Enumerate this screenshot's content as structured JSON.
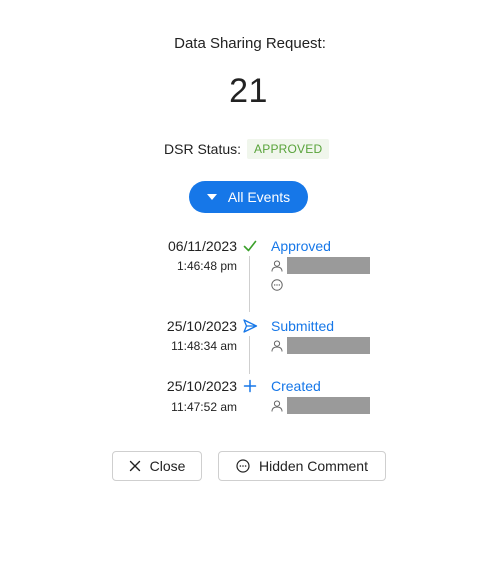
{
  "title": "Data Sharing Request:",
  "request_number": "21",
  "status": {
    "label": "DSR Status:",
    "value": "APPROVED",
    "color": "#58a33a"
  },
  "events_filter": {
    "label": "All Events",
    "icon": "caret-down-icon",
    "color": "#1677e8"
  },
  "events": [
    {
      "date": "06/11/2023",
      "time": "1:46:48 pm",
      "title": "Approved",
      "icon": "check-icon",
      "icon_color": "#3ba02b"
    },
    {
      "date": "25/10/2023",
      "time": "11:48:34 am",
      "title": "Submitted",
      "icon": "send-icon",
      "icon_color": "#1677e8"
    },
    {
      "date": "25/10/2023",
      "time": "11:47:52 am",
      "title": "Created",
      "icon": "plus-icon",
      "icon_color": "#1677e8"
    }
  ],
  "footer": {
    "close_label": "Close",
    "hidden_comment_label": "Hidden Comment"
  }
}
